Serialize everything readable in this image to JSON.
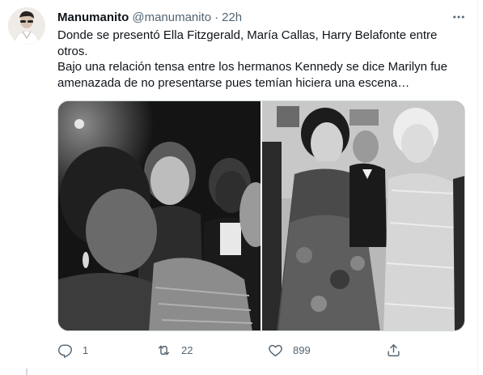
{
  "tweet": {
    "author_name": "Manumanito",
    "author_handle": "@manumanito",
    "separator": "·",
    "timestamp": "22h",
    "text_line_1": "Donde se presentó Ella Fitzgerald, María Callas, Harry Belafonte entre otros.",
    "text_line_2": "Bajo una relación tensa entre los hermanos Kennedy se dice Marilyn fue amenazada de no presentarse pues temían hiciera una escena…"
  },
  "actions": {
    "reply_count": "1",
    "retweet_count": "22",
    "like_count": "899"
  },
  "icons": {
    "more": "more-icon",
    "reply": "reply-icon",
    "retweet": "retweet-icon",
    "like": "heart-icon",
    "share": "share-icon"
  },
  "colors": {
    "text_primary": "#0f1419",
    "text_secondary": "#536471",
    "border": "#cfd9de"
  }
}
